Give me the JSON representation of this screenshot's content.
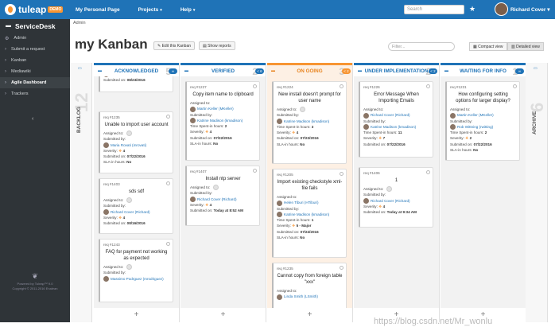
{
  "topbar": {
    "logo_text": "tuleap",
    "demo_badge": "DEMO",
    "nav": [
      "My Personal Page",
      "Projects",
      "Help"
    ],
    "search_placeholder": "Search",
    "user_name": "Richard Cover"
  },
  "sidebar": {
    "title": "ServiceDesk",
    "items": [
      "Admin",
      "Submit a request",
      "Kanban",
      "Mediawiki",
      "Agile Dashboard",
      "Trackers"
    ],
    "active_index": 4,
    "footer_line1": "Powered by Tuleap™ 9.0",
    "footer_line2": "Copyright © 2011-2016 Enalean"
  },
  "breadcrumb": "Admin",
  "page": {
    "title": "my Kanban",
    "edit_button": "Edit this Kanban",
    "reports_button": "Show reports",
    "filter_placeholder": "Filter...",
    "compact_view": "Compact view",
    "detailed_view": "Detailed view"
  },
  "backlog": {
    "label": "BACKLOG",
    "count": "12"
  },
  "archive": {
    "label": "ARCHIVE",
    "count": "6"
  },
  "columns": [
    {
      "label": "ACKNOWLEDGED",
      "count": "5",
      "pill": "∞",
      "orange": false,
      "cards": [
        {
          "ref": "",
          "title": "",
          "rows": [
            [
              "Submitted by:",
              "Ernie (admin)"
            ],
            [
              "Submitted on:",
              "08/23/2016"
            ]
          ]
        },
        {
          "ref": "req #1235",
          "title": "Unable to import user account",
          "rows": [
            [
              "Assigned to:",
              ""
            ],
            [
              "Submitted by:",
              "Maria Rovati (mrovati)"
            ],
            [
              "Severity:",
              "4"
            ],
            [
              "Submitted on:",
              "07/22/2016"
            ],
            [
              "SLA-in hours:",
              "No"
            ]
          ]
        },
        {
          "ref": "req #1403",
          "title": "sds sdf",
          "rows": [
            [
              "Assigned to:",
              ""
            ],
            [
              "Submitted by:",
              "Richard Cover (Richard)"
            ],
            [
              "Severity:",
              "4"
            ],
            [
              "Submitted on:",
              "08/16/2016"
            ]
          ]
        },
        {
          "ref": "req #1243",
          "title": "FAQ for payment not working as expected",
          "rows": [
            [
              "Assigned to:",
              ""
            ],
            [
              "Submitted by:",
              "Massimo Podrguez (mrodriguez)"
            ]
          ]
        }
      ]
    },
    {
      "label": "VERIFIED",
      "count": "2",
      "pill": "< 6",
      "orange": false,
      "cards": [
        {
          "ref": "req #1227",
          "title": "Copy item name to clipboard",
          "rows": [
            [
              "Assigned to:",
              "Martin Keller (MKeller)"
            ],
            [
              "Submitted by:",
              "Katrine Madison (kmadison)"
            ],
            [
              "Time Spent-in hours:",
              "2"
            ],
            [
              "Severity:",
              "4"
            ],
            [
              "Submitted on:",
              "07/22/2016"
            ],
            [
              "SLA-in hours:",
              "No"
            ]
          ]
        },
        {
          "ref": "req #1407",
          "title": "Install ntp server",
          "rows": [
            [
              "Assigned to:",
              ""
            ],
            [
              "Submitted by:",
              "Richard Cover (Richard)"
            ],
            [
              "Severity:",
              "4"
            ],
            [
              "Submitted on:",
              "Today at 8:52 AM"
            ]
          ]
        }
      ]
    },
    {
      "label": "ON GOING",
      "count": "3",
      "pill": "< 2",
      "orange": true,
      "cards": [
        {
          "ref": "req #1224",
          "title": "New install doesn't prompt for user name",
          "rows": [
            [
              "Assigned to:",
              ""
            ],
            [
              "Submitted by:",
              "Katrine Madison (kmadison)"
            ],
            [
              "Time Spent-in hours:",
              "3"
            ],
            [
              "Severity:",
              "4"
            ],
            [
              "Submitted on:",
              "07/22/2016"
            ],
            [
              "SLA-in hours:",
              "No"
            ]
          ]
        },
        {
          "ref": "req #1205",
          "title": "Import existing checkstyle xml-file fails",
          "rows": [
            [
              "Assigned to:",
              "Helen Tiburi (HTiburi)"
            ],
            [
              "Submitted by:",
              "Katrine Madison (kmadison)"
            ],
            [
              "Time Spent-in hours:",
              "1"
            ],
            [
              "Severity:",
              "5 - Major"
            ],
            [
              "Submitted on:",
              "07/22/2016"
            ],
            [
              "SLA-in hours:",
              "No"
            ]
          ]
        },
        {
          "ref": "req #1235",
          "title": "Cannot copy from foreign table \"xxx\"",
          "rows": [
            [
              "Assigned to:",
              "Linda Smith (LSmith)"
            ]
          ]
        }
      ]
    },
    {
      "label": "UNDER IMPLEMENTATION",
      "count": "2",
      "pill": "< 2",
      "orange": false,
      "cards": [
        {
          "ref": "req #1226",
          "title": "Error Message When Importing Emails",
          "rows": [
            [
              "Assigned to:",
              "Richard Cover (Richard)"
            ],
            [
              "Submitted by:",
              "Katrine Madison (kmadison)"
            ],
            [
              "Time Spent-in hours:",
              "11"
            ],
            [
              "Severity:",
              "7"
            ],
            [
              "Submitted on:",
              "07/22/2016"
            ]
          ]
        },
        {
          "ref": "req #1406",
          "title": "1",
          "rows": [
            [
              "Assigned to:",
              ""
            ],
            [
              "Submitted by:",
              "Richard Cover (Richard)"
            ],
            [
              "Severity:",
              "4"
            ],
            [
              "Submitted on:",
              "Today at 9:34 AM"
            ]
          ]
        }
      ]
    },
    {
      "label": "WAITING FOR INFO",
      "count": "1",
      "pill": "∞",
      "orange": false,
      "cards": [
        {
          "ref": "req #1231",
          "title": "How configuring setting options for larger display?",
          "rows": [
            [
              "Assigned to:",
              "Martin Keller (MKeller)"
            ],
            [
              "Submitted by:",
              "Rob Wittning (rwitting)"
            ],
            [
              "Time Spent-in hours:",
              "2"
            ],
            [
              "Severity:",
              "2"
            ],
            [
              "Submitted on:",
              "07/22/2016"
            ],
            [
              "SLA-in hours:",
              "No"
            ]
          ]
        }
      ]
    }
  ],
  "add_label": "+",
  "watermark": "https://blog.csdn.net/Mr_wonlu"
}
